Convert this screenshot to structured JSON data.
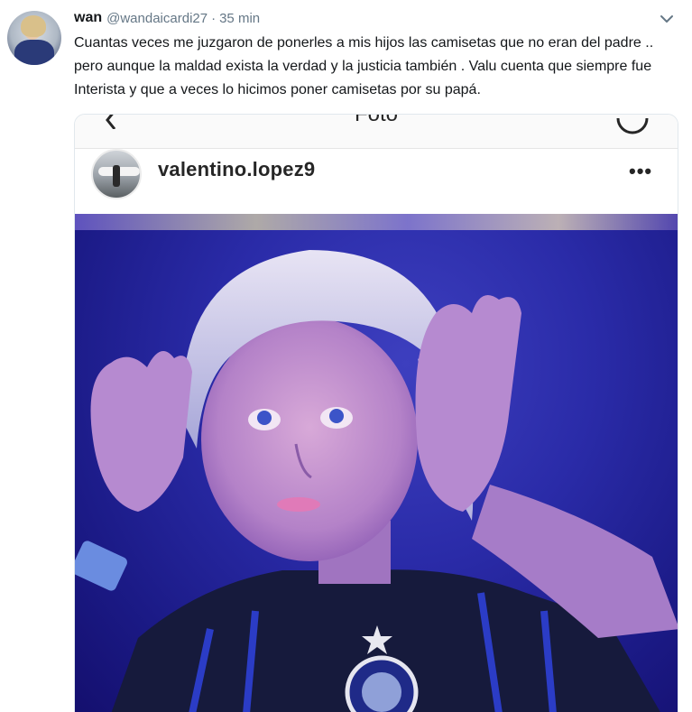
{
  "tweet": {
    "author_name": "wan",
    "author_handle": "@wandaicardi27",
    "separator": "·",
    "timestamp": "35 min",
    "text": "Cuantas veces me juzgaron de ponerles a mis hijos las camisetas que no eran del padre .. pero aunque la maldad exista la verdad y la justicia también . Valu cuenta que siempre fue Interista y que a veces lo hicimos poner camisetas por su papá."
  },
  "instagram_screenshot": {
    "title": "Foto",
    "username": "valentino.lopez9",
    "more_label": "•••"
  },
  "colors": {
    "handle_gray": "#657786",
    "photo_blue": "#2a2ba8"
  },
  "icons": {
    "tweet_menu": "chevron-down-icon",
    "ig_back": "back-arrow-icon",
    "ig_refresh": "refresh-icon",
    "ig_more": "more-dots-icon"
  }
}
